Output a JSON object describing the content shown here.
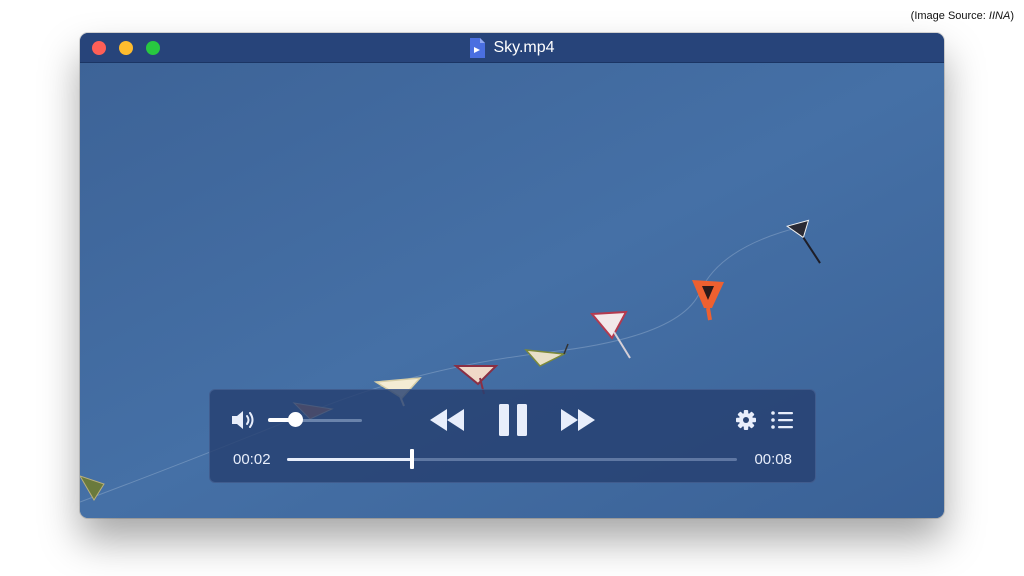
{
  "source_note": {
    "prefix": "(Image Source: ",
    "name": "IINA",
    "suffix": ")"
  },
  "window": {
    "title": "Sky.mp4",
    "file_icon": "video-file-icon"
  },
  "player": {
    "current_time": "00:02",
    "duration": "00:08",
    "progress_fraction": 0.27,
    "volume_fraction": 0.28,
    "state": "playing",
    "icons": [
      "volume-icon",
      "rewind-icon",
      "pause-icon",
      "fast-forward-icon",
      "settings-gear-icon",
      "playlist-icon"
    ]
  },
  "colors": {
    "titlebar": "#27447a",
    "sky": "#3f689c",
    "close": "#fe5f57",
    "minimize": "#febc2e",
    "maximize": "#28c840",
    "controls_bg": "#264070"
  }
}
